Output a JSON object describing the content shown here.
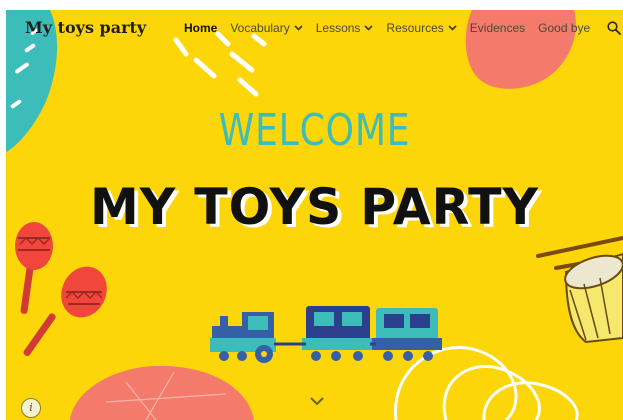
{
  "header": {
    "site_title": "My toys party",
    "nav": [
      {
        "label": "Home",
        "active": true,
        "has_menu": false
      },
      {
        "label": "Vocabulary",
        "active": false,
        "has_menu": true
      },
      {
        "label": "Lessons",
        "active": false,
        "has_menu": true
      },
      {
        "label": "Resources",
        "active": false,
        "has_menu": true
      },
      {
        "label": "Evidences",
        "active": false,
        "has_menu": false
      },
      {
        "label": "Good bye",
        "active": false,
        "has_menu": false
      }
    ],
    "search_icon": "search-icon"
  },
  "hero": {
    "welcome": "WELCOME",
    "headline": "MY TOYS PARTY"
  },
  "icons": {
    "scroll_down": "chevron-down-icon",
    "info": "info-icon",
    "dropdown": "chevron-down-icon"
  },
  "colors": {
    "background": "#fcd608",
    "accent_teal": "#3dbdb9",
    "accent_coral": "#f47a6b",
    "train_blue": "#3560a8"
  }
}
